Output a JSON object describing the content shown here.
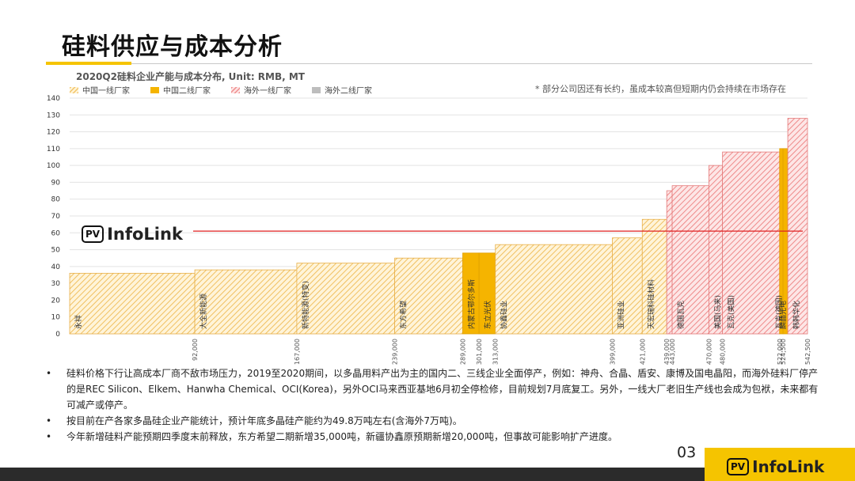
{
  "page": {
    "title": "硅料供应与成本分析",
    "page_number": "03",
    "logo_badge": "PV",
    "logo_text": "InfoLink"
  },
  "colors": {
    "accent": "#f5c400",
    "reference_line": "#e02020",
    "footer": "#2b2b2b"
  },
  "chart": {
    "title": "2020Q2硅料企业产能与成本分布, Unit: RMB, MT",
    "note": "* 部分公司因还有长约，虽成本较高但短期内仍会持续在市场存在",
    "legend": [
      {
        "key": "cn1",
        "label": "中国一线厂家"
      },
      {
        "key": "cn2",
        "label": "中国二线厂家"
      },
      {
        "key": "os1",
        "label": "海外一线厂家"
      },
      {
        "key": "os2",
        "label": "海外二线厂家"
      }
    ]
  },
  "chart_data": {
    "type": "bar",
    "subtype": "cost-curve",
    "y_ticks": [
      "0",
      "10",
      "20",
      "30",
      "40",
      "50",
      "60",
      "70",
      "80",
      "90",
      "100",
      "110",
      "120",
      "130",
      "140"
    ],
    "ylim": [
      0,
      140
    ],
    "xlim": [
      0,
      542500
    ],
    "reference_line": 61,
    "series": [
      {
        "name": "永祥",
        "start": 0,
        "end": 92000,
        "cost": 36,
        "group": "cn1"
      },
      {
        "name": "大全新能源",
        "start": 92000,
        "end": 167000,
        "cost": 38,
        "group": "cn1"
      },
      {
        "name": "新特能源(特变)",
        "start": 167000,
        "end": 239000,
        "cost": 42,
        "group": "cn1"
      },
      {
        "name": "东方希望",
        "start": 239000,
        "end": 289000,
        "cost": 45,
        "group": "cn1"
      },
      {
        "name": "内蒙古鄂尔多斯",
        "start": 289000,
        "end": 301000,
        "cost": 48,
        "group": "cn2"
      },
      {
        "name": "东立光伏",
        "start": 301000,
        "end": 313000,
        "cost": 48,
        "group": "cn2"
      },
      {
        "name": "协鑫硅业",
        "start": 313000,
        "end": 399000,
        "cost": 53,
        "group": "cn1"
      },
      {
        "name": "亚洲硅业",
        "start": 399000,
        "end": 421000,
        "cost": 57,
        "group": "cn1"
      },
      {
        "name": "天宏瑞科硅材料",
        "start": 421000,
        "end": 439000,
        "cost": 68,
        "group": "cn1"
      },
      {
        "name": "",
        "start": 439000,
        "end": 443000,
        "cost": 85,
        "group": "os1"
      },
      {
        "name": "德国瓦克",
        "start": 443000,
        "end": 470000,
        "cost": 88,
        "group": "os1"
      },
      {
        "name": "美国(马来)",
        "start": 470000,
        "end": 480000,
        "cost": 100,
        "group": "os1"
      },
      {
        "name": "瓦克(美国)",
        "start": 480000,
        "end": 522000,
        "cost": 108,
        "group": "os1"
      },
      {
        "name": "瓦克(德国)",
        "start": 522000,
        "end": 524500,
        "cost": 110,
        "group": "cn2"
      },
      {
        "name": "麟晶光电",
        "start": 524500,
        "end": 528000,
        "cost": 110,
        "group": "cn2"
      },
      {
        "name": "韩韩华化",
        "start": 528000,
        "end": 542500,
        "cost": 128,
        "group": "os1"
      }
    ],
    "x_tick_labels": [
      "92,000",
      "167,000",
      "239,000",
      "289,000",
      "301,000",
      "313,000",
      "399,000",
      "421,000",
      "439,000",
      "443,000",
      "470,000",
      "480,000",
      "522,000",
      "524,500",
      "542,500"
    ]
  },
  "bullets": [
    "硅料价格下行让高成本厂商不敌市场压力，2019至2020期间，以多晶用料产出为主的国内二、三线企业全面停产，例如：神舟、合晶、盾安、康博及国电晶阳，而海外硅料厂停产的是REC Silicon、Elkem、Hanwha Chemical、OCI(Korea)，另外OCI马来西亚基地6月初全停检修，目前规划7月底复工。另外，一线大厂老旧生产线也会成为包袱，未来都有可减产或停产。",
    "按目前在产各家多晶硅企业产能统计，预计年底多晶硅产能约为49.8万吨左右(含海外7万吨)。",
    "今年新增硅料产能预期四季度末前释放，东方希望二期新增35,000吨，新疆协鑫原预期新增20,000吨，但事故可能影响扩产进度。"
  ]
}
